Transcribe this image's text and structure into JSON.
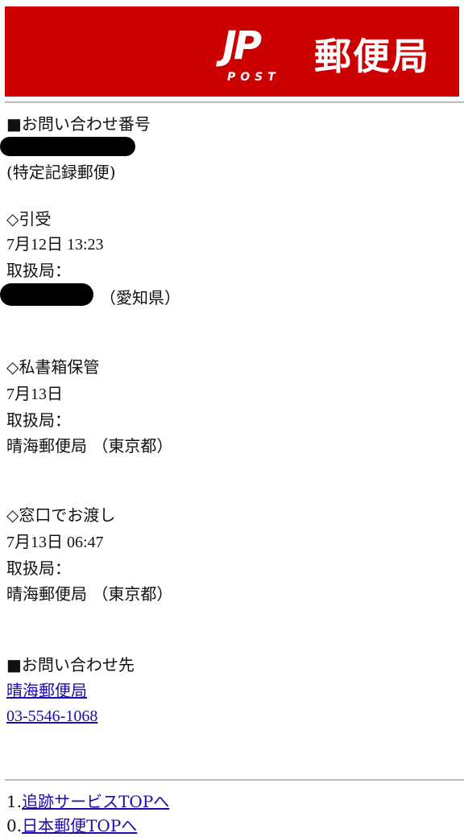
{
  "header": {
    "logo_jp": "JP",
    "logo_post": "POST",
    "brand": "郵便局",
    "bg_color": "#cc0000"
  },
  "inquiry": {
    "heading": "■お問い合わせ番号",
    "service": "(特定記録郵便)"
  },
  "events": [
    {
      "title": "◇引受",
      "datetime": "7月12日 13:23",
      "office_label": "取扱局：",
      "office": "（愛知県）"
    },
    {
      "title": "◇私書箱保管",
      "datetime": "7月13日",
      "office_label": "取扱局：",
      "office": "晴海郵便局 （東京都）"
    },
    {
      "title": "◇窓口でお渡し",
      "datetime": "7月13日 06:47",
      "office_label": "取扱局：",
      "office": "晴海郵便局 （東京都）"
    }
  ],
  "contact": {
    "heading": "■お問い合わせ先",
    "office_link": "晴海郵便局",
    "phone_link": "03-5546-1068"
  },
  "footer_links": [
    {
      "prefix": "1.",
      "label": "追跡サービスTOPへ"
    },
    {
      "prefix": "0.",
      "label": "日本郵便TOPへ"
    }
  ]
}
